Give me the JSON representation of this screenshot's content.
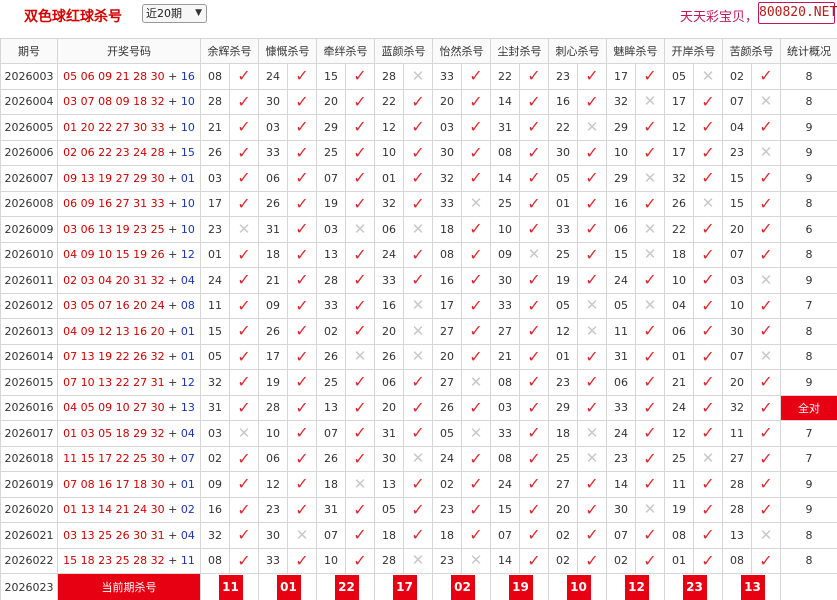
{
  "header": {
    "title": "双色球红球杀号",
    "period_select": "近20期",
    "brand_text": "天天彩宝贝，",
    "brand_domain": "800820.NET"
  },
  "table": {
    "columns": [
      "期号",
      "开奖号码",
      "余辉杀号",
      "慷慨杀号",
      "牵绊杀号",
      "蓝颜杀号",
      "怡然杀号",
      "尘封杀号",
      "刺心杀号",
      "魅眸杀号",
      "开岸杀号",
      "苦颜杀号",
      "统计概况"
    ],
    "rows": [
      {
        "issue": "2026003",
        "reds": "05 06 09 21 28 30",
        "blue": "16",
        "kills": [
          [
            "08",
            "ok"
          ],
          [
            "24",
            "ok"
          ],
          [
            "15",
            "ok"
          ],
          [
            "28",
            "no"
          ],
          [
            "33",
            "ok"
          ],
          [
            "22",
            "ok"
          ],
          [
            "23",
            "ok"
          ],
          [
            "17",
            "ok"
          ],
          [
            "05",
            "no"
          ],
          [
            "02",
            "ok"
          ]
        ],
        "stat": "8"
      },
      {
        "issue": "2026004",
        "reds": "03 07 08 09 18 32",
        "blue": "10",
        "kills": [
          [
            "28",
            "ok"
          ],
          [
            "30",
            "ok"
          ],
          [
            "20",
            "ok"
          ],
          [
            "22",
            "ok"
          ],
          [
            "20",
            "ok"
          ],
          [
            "14",
            "ok"
          ],
          [
            "16",
            "ok"
          ],
          [
            "32",
            "no"
          ],
          [
            "17",
            "ok"
          ],
          [
            "07",
            "no"
          ]
        ],
        "stat": "8"
      },
      {
        "issue": "2026005",
        "reds": "01 20 22 27 30 33",
        "blue": "10",
        "kills": [
          [
            "21",
            "ok"
          ],
          [
            "03",
            "ok"
          ],
          [
            "29",
            "ok"
          ],
          [
            "12",
            "ok"
          ],
          [
            "03",
            "ok"
          ],
          [
            "31",
            "ok"
          ],
          [
            "22",
            "no"
          ],
          [
            "29",
            "ok"
          ],
          [
            "12",
            "ok"
          ],
          [
            "04",
            "ok"
          ]
        ],
        "stat": "9"
      },
      {
        "issue": "2026006",
        "reds": "02 06 22 23 24 28",
        "blue": "15",
        "kills": [
          [
            "26",
            "ok"
          ],
          [
            "33",
            "ok"
          ],
          [
            "25",
            "ok"
          ],
          [
            "10",
            "ok"
          ],
          [
            "30",
            "ok"
          ],
          [
            "08",
            "ok"
          ],
          [
            "30",
            "ok"
          ],
          [
            "10",
            "ok"
          ],
          [
            "17",
            "ok"
          ],
          [
            "23",
            "no"
          ]
        ],
        "stat": "9"
      },
      {
        "issue": "2026007",
        "reds": "09 13 19 27 29 30",
        "blue": "01",
        "kills": [
          [
            "03",
            "ok"
          ],
          [
            "06",
            "ok"
          ],
          [
            "07",
            "ok"
          ],
          [
            "01",
            "ok"
          ],
          [
            "32",
            "ok"
          ],
          [
            "14",
            "ok"
          ],
          [
            "05",
            "ok"
          ],
          [
            "29",
            "no"
          ],
          [
            "32",
            "ok"
          ],
          [
            "15",
            "ok"
          ]
        ],
        "stat": "9"
      },
      {
        "issue": "2026008",
        "reds": "06 09 16 27 31 33",
        "blue": "10",
        "kills": [
          [
            "17",
            "ok"
          ],
          [
            "26",
            "ok"
          ],
          [
            "19",
            "ok"
          ],
          [
            "32",
            "ok"
          ],
          [
            "33",
            "no"
          ],
          [
            "25",
            "ok"
          ],
          [
            "01",
            "ok"
          ],
          [
            "16",
            "ok"
          ],
          [
            "26",
            "no"
          ],
          [
            "15",
            "ok"
          ]
        ],
        "stat": "8"
      },
      {
        "issue": "2026009",
        "reds": "03 06 13 19 23 25",
        "blue": "10",
        "kills": [
          [
            "23",
            "no"
          ],
          [
            "31",
            "ok"
          ],
          [
            "03",
            "no"
          ],
          [
            "06",
            "no"
          ],
          [
            "18",
            "ok"
          ],
          [
            "10",
            "ok"
          ],
          [
            "33",
            "ok"
          ],
          [
            "06",
            "no"
          ],
          [
            "22",
            "ok"
          ],
          [
            "20",
            "ok"
          ]
        ],
        "stat": "6"
      },
      {
        "issue": "2026010",
        "reds": "04 09 10 15 19 26",
        "blue": "12",
        "kills": [
          [
            "01",
            "ok"
          ],
          [
            "18",
            "ok"
          ],
          [
            "13",
            "ok"
          ],
          [
            "24",
            "ok"
          ],
          [
            "08",
            "ok"
          ],
          [
            "09",
            "no"
          ],
          [
            "25",
            "ok"
          ],
          [
            "15",
            "no"
          ],
          [
            "18",
            "ok"
          ],
          [
            "07",
            "ok"
          ]
        ],
        "stat": "8"
      },
      {
        "issue": "2026011",
        "reds": "02 03 04 20 31 32",
        "blue": "04",
        "kills": [
          [
            "24",
            "ok"
          ],
          [
            "21",
            "ok"
          ],
          [
            "28",
            "ok"
          ],
          [
            "33",
            "ok"
          ],
          [
            "16",
            "ok"
          ],
          [
            "30",
            "ok"
          ],
          [
            "19",
            "ok"
          ],
          [
            "24",
            "ok"
          ],
          [
            "10",
            "ok"
          ],
          [
            "03",
            "no"
          ]
        ],
        "stat": "9"
      },
      {
        "issue": "2026012",
        "reds": "03 05 07 16 20 24",
        "blue": "08",
        "kills": [
          [
            "11",
            "ok"
          ],
          [
            "09",
            "ok"
          ],
          [
            "33",
            "ok"
          ],
          [
            "16",
            "no"
          ],
          [
            "17",
            "ok"
          ],
          [
            "33",
            "ok"
          ],
          [
            "05",
            "no"
          ],
          [
            "05",
            "no"
          ],
          [
            "04",
            "ok"
          ],
          [
            "10",
            "ok"
          ]
        ],
        "stat": "7"
      },
      {
        "issue": "2026013",
        "reds": "04 09 12 13 16 20",
        "blue": "01",
        "kills": [
          [
            "15",
            "ok"
          ],
          [
            "26",
            "ok"
          ],
          [
            "02",
            "ok"
          ],
          [
            "20",
            "no"
          ],
          [
            "27",
            "ok"
          ],
          [
            "27",
            "ok"
          ],
          [
            "12",
            "no"
          ],
          [
            "11",
            "ok"
          ],
          [
            "06",
            "ok"
          ],
          [
            "30",
            "ok"
          ]
        ],
        "stat": "8"
      },
      {
        "issue": "2026014",
        "reds": "07 13 19 22 26 32",
        "blue": "01",
        "kills": [
          [
            "05",
            "ok"
          ],
          [
            "17",
            "ok"
          ],
          [
            "26",
            "no"
          ],
          [
            "26",
            "no"
          ],
          [
            "20",
            "ok"
          ],
          [
            "21",
            "ok"
          ],
          [
            "01",
            "ok"
          ],
          [
            "31",
            "ok"
          ],
          [
            "01",
            "ok"
          ],
          [
            "07",
            "no"
          ]
        ],
        "stat": "8"
      },
      {
        "issue": "2026015",
        "reds": "07 10 13 22 27 31",
        "blue": "12",
        "kills": [
          [
            "32",
            "ok"
          ],
          [
            "19",
            "ok"
          ],
          [
            "25",
            "ok"
          ],
          [
            "06",
            "ok"
          ],
          [
            "27",
            "no"
          ],
          [
            "08",
            "ok"
          ],
          [
            "23",
            "ok"
          ],
          [
            "06",
            "ok"
          ],
          [
            "21",
            "ok"
          ],
          [
            "20",
            "ok"
          ]
        ],
        "stat": "9"
      },
      {
        "issue": "2026016",
        "reds": "04 05 09 10 27 30",
        "blue": "13",
        "kills": [
          [
            "31",
            "ok"
          ],
          [
            "28",
            "ok"
          ],
          [
            "13",
            "ok"
          ],
          [
            "20",
            "ok"
          ],
          [
            "26",
            "ok"
          ],
          [
            "03",
            "ok"
          ],
          [
            "29",
            "ok"
          ],
          [
            "33",
            "ok"
          ],
          [
            "24",
            "ok"
          ],
          [
            "32",
            "ok"
          ]
        ],
        "stat": "全对"
      },
      {
        "issue": "2026017",
        "reds": "01 03 05 18 29 32",
        "blue": "04",
        "kills": [
          [
            "03",
            "no"
          ],
          [
            "10",
            "ok"
          ],
          [
            "07",
            "ok"
          ],
          [
            "31",
            "ok"
          ],
          [
            "05",
            "no"
          ],
          [
            "33",
            "ok"
          ],
          [
            "18",
            "no"
          ],
          [
            "24",
            "ok"
          ],
          [
            "12",
            "ok"
          ],
          [
            "11",
            "ok"
          ]
        ],
        "stat": "7"
      },
      {
        "issue": "2026018",
        "reds": "11 15 17 22 25 30",
        "blue": "07",
        "kills": [
          [
            "02",
            "ok"
          ],
          [
            "06",
            "ok"
          ],
          [
            "26",
            "ok"
          ],
          [
            "30",
            "no"
          ],
          [
            "24",
            "ok"
          ],
          [
            "08",
            "ok"
          ],
          [
            "25",
            "no"
          ],
          [
            "23",
            "ok"
          ],
          [
            "25",
            "no"
          ],
          [
            "27",
            "ok"
          ]
        ],
        "stat": "7"
      },
      {
        "issue": "2026019",
        "reds": "07 08 16 17 18 30",
        "blue": "01",
        "kills": [
          [
            "09",
            "ok"
          ],
          [
            "12",
            "ok"
          ],
          [
            "18",
            "no"
          ],
          [
            "13",
            "ok"
          ],
          [
            "02",
            "ok"
          ],
          [
            "24",
            "ok"
          ],
          [
            "27",
            "ok"
          ],
          [
            "14",
            "ok"
          ],
          [
            "11",
            "ok"
          ],
          [
            "28",
            "ok"
          ]
        ],
        "stat": "9"
      },
      {
        "issue": "2026020",
        "reds": "01 13 14 21 24 30",
        "blue": "02",
        "kills": [
          [
            "16",
            "ok"
          ],
          [
            "23",
            "ok"
          ],
          [
            "31",
            "ok"
          ],
          [
            "05",
            "ok"
          ],
          [
            "23",
            "ok"
          ],
          [
            "15",
            "ok"
          ],
          [
            "20",
            "ok"
          ],
          [
            "30",
            "no"
          ],
          [
            "19",
            "ok"
          ],
          [
            "28",
            "ok"
          ]
        ],
        "stat": "9"
      },
      {
        "issue": "2026021",
        "reds": "03 13 25 26 30 31",
        "blue": "04",
        "kills": [
          [
            "32",
            "ok"
          ],
          [
            "30",
            "no"
          ],
          [
            "07",
            "ok"
          ],
          [
            "18",
            "ok"
          ],
          [
            "18",
            "ok"
          ],
          [
            "07",
            "ok"
          ],
          [
            "02",
            "ok"
          ],
          [
            "07",
            "ok"
          ],
          [
            "08",
            "ok"
          ],
          [
            "13",
            "no"
          ]
        ],
        "stat": "8"
      },
      {
        "issue": "2026022",
        "reds": "15 18 23 25 28 32",
        "blue": "11",
        "kills": [
          [
            "08",
            "ok"
          ],
          [
            "33",
            "ok"
          ],
          [
            "10",
            "ok"
          ],
          [
            "28",
            "no"
          ],
          [
            "23",
            "no"
          ],
          [
            "14",
            "ok"
          ],
          [
            "02",
            "ok"
          ],
          [
            "02",
            "ok"
          ],
          [
            "01",
            "ok"
          ],
          [
            "08",
            "ok"
          ]
        ],
        "stat": "8"
      }
    ],
    "prediction": {
      "issue": "2026023",
      "label": "当前期杀号",
      "kills": [
        "11",
        "01",
        "22",
        "17",
        "02",
        "19",
        "10",
        "12",
        "23",
        "13"
      ]
    }
  },
  "icons": {
    "hit": "check-icon",
    "miss": "cross-icon"
  },
  "colors": {
    "red_ball": "#d00000",
    "blue_ball": "#1a35b5",
    "accent": "#e60012",
    "check": "#e0292f",
    "cross": "#c8c8c8"
  }
}
